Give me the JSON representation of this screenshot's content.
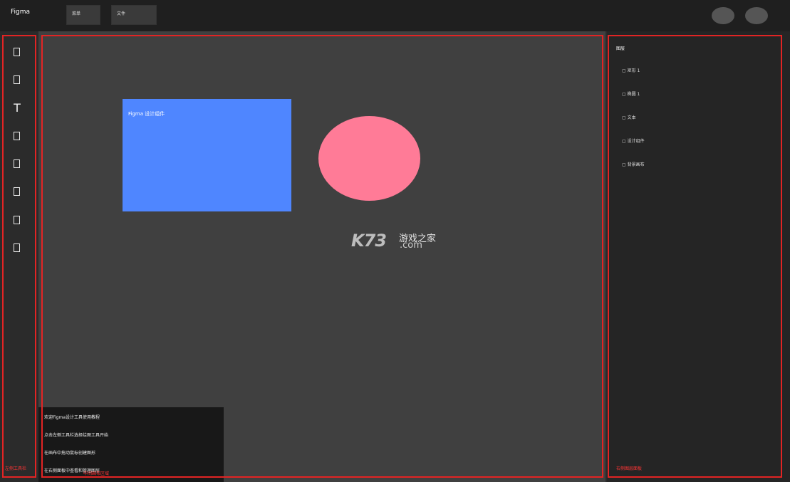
{
  "app": {
    "title": "Figma"
  },
  "menu": [
    "菜单",
    "文件"
  ],
  "toolbar": {
    "tools": [
      {
        "name": "move-tool-icon",
        "glyph": ""
      },
      {
        "name": "frame-tool-icon",
        "glyph": ""
      },
      {
        "name": "text-tool-icon",
        "glyph": "T"
      },
      {
        "name": "rectangle-tool-icon",
        "glyph": ""
      },
      {
        "name": "ellipse-tool-icon",
        "glyph": ""
      },
      {
        "name": "pen-tool-icon",
        "glyph": ""
      },
      {
        "name": "hand-tool-icon",
        "glyph": ""
      },
      {
        "name": "comment-tool-icon",
        "glyph": ""
      }
    ]
  },
  "canvas": {
    "rect_label": "Figma 设计组件",
    "colors": {
      "rect": "#4f86ff",
      "ellipse": "#ff7b97",
      "bg": "#404040"
    }
  },
  "watermark": {
    "brand": "K73",
    "cn": "游戏之家",
    "domain": ".com"
  },
  "layers": {
    "title": "图层",
    "items": [
      "▢ 矩形 1",
      "▢ 椭圆 1",
      "▢ 文本",
      "▢ 设计组件",
      "▢ 背景画布"
    ]
  },
  "bottom_panel": {
    "lines": [
      "欢迎Figma设计工具使用教程",
      "点击左侧工具栏选择绘图工具开始",
      "在画布中拖动鼠标创建图形",
      "在右侧面板中查看和管理图层"
    ]
  },
  "annotations": {
    "left": "左侧工具栏",
    "canvas": "中间画布区域",
    "right": "右侧图层面板"
  }
}
